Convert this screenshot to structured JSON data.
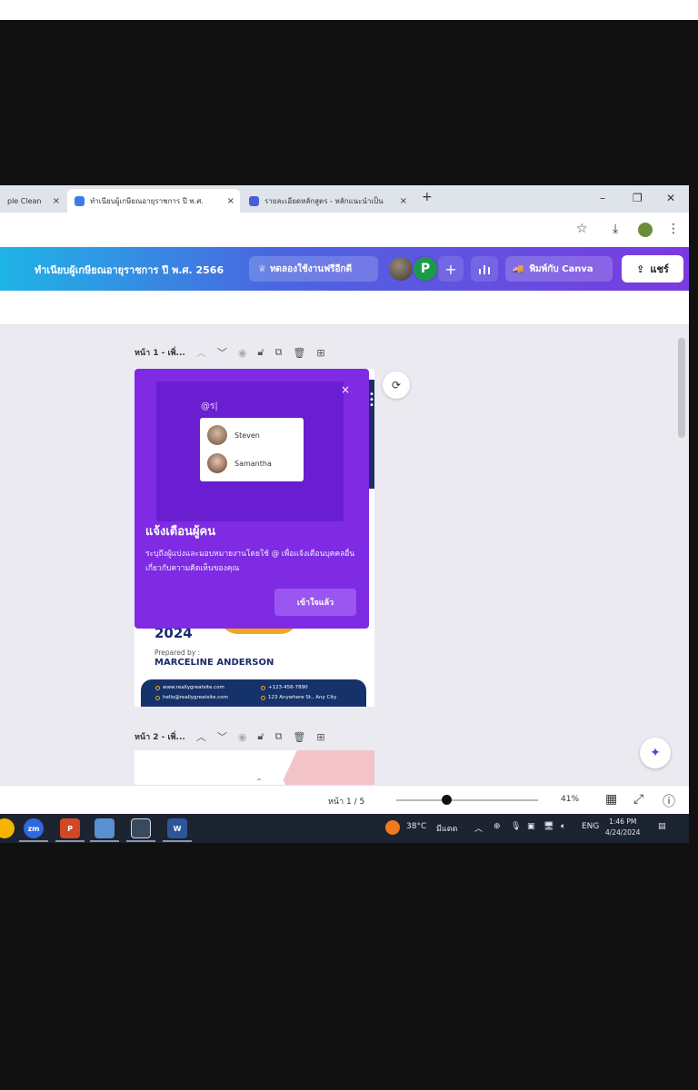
{
  "browser": {
    "tabs": [
      {
        "label": "ple Clean"
      },
      {
        "label": "ทำเนียบผู้เกษียณอายุราชการ ปี พ.ศ."
      },
      {
        "label": "รายละเอียดหลักสูตร - หลักแนะนำเป็น"
      }
    ],
    "new_tab": "+",
    "close_tab": "×",
    "win_min": "–",
    "win_restore": "❐",
    "win_close": "✕"
  },
  "canva": {
    "doc_title": "ทำเนียบผู้เกษียณอายุราชการ ปี พ.ศ. 2566",
    "trial_label": "ทดลองใช้งานฟรีอีกดี",
    "avatar_letter": "P",
    "add_label": "+",
    "print_label": "พิมพ์กับ Canva",
    "share_label": "แชร์"
  },
  "editor": {
    "page1_label": "หน้า 1 - เพิ่...",
    "page2_label": "หน้า 2 - เพิ่...",
    "page_indicator": "หน้า 1 / 5",
    "zoom": "41%",
    "zoom_fraction": 0.35
  },
  "popup": {
    "mention_input": "@ร|",
    "mentions": [
      {
        "name": "Steven"
      },
      {
        "name": "Samantha"
      }
    ],
    "title": "แจ้งเตือนผู้คน",
    "body": "ระบุถึงผู้แบ่งและมอบหมายงานโดยใช้ @ เพื่อแจ้งเตือนบุคคลอื่นเกี่ยวกับความคิดเห็นของคุณ",
    "button": "เข้าใจแล้ว",
    "close": "×"
  },
  "design": {
    "year": "2024",
    "prepared_by": "Prepared by :",
    "author": "MARCELINE ANDERSON",
    "contacts": [
      "www.reallygreatsite.com",
      "+123-456-7890",
      "hello@reallygreatsite.com",
      "123 Anywhere St., Any City"
    ]
  },
  "taskbar": {
    "zoom_app": "zm",
    "ppt_app": "P",
    "word_app": "W",
    "temperature": "38°C",
    "weather": "มีแดด",
    "lang": "ENG",
    "time": "1:46 PM",
    "date": "4/24/2024"
  },
  "colors": {
    "canva_purple": "#7e2be3",
    "navy": "#16326a",
    "orange": "#f2a51f"
  }
}
